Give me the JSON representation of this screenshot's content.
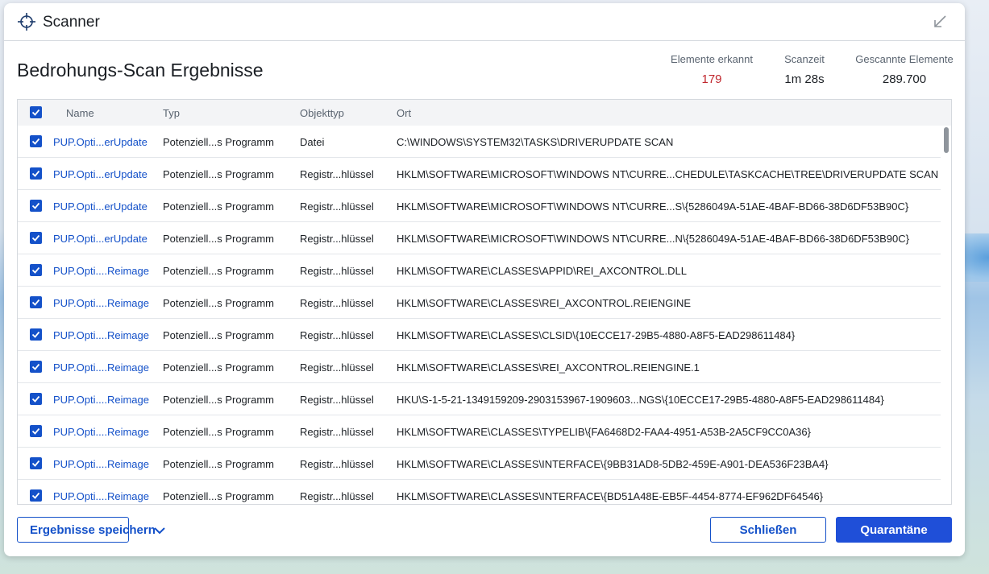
{
  "window": {
    "title": "Scanner"
  },
  "heading": "Bedrohungs-Scan Ergebnisse",
  "stats": {
    "detected_label": "Elemente erkannt",
    "detected_value": "179",
    "time_label": "Scanzeit",
    "time_value": "1m 28s",
    "scanned_label": "Gescannte Elemente",
    "scanned_value": "289.700"
  },
  "table": {
    "columns": [
      "Name",
      "Typ",
      "Objekttyp",
      "Ort"
    ],
    "rows": [
      {
        "name": "PUP.Opti...erUpdate",
        "typ": "Potenziell...s Programm",
        "obj": "Datei",
        "ort": "C:\\WINDOWS\\SYSTEM32\\TASKS\\DRIVERUPDATE SCAN"
      },
      {
        "name": "PUP.Opti...erUpdate",
        "typ": "Potenziell...s Programm",
        "obj": "Registr...hlüssel",
        "ort": "HKLM\\SOFTWARE\\MICROSOFT\\WINDOWS NT\\CURRE...CHEDULE\\TASKCACHE\\TREE\\DRIVERUPDATE SCAN"
      },
      {
        "name": "PUP.Opti...erUpdate",
        "typ": "Potenziell...s Programm",
        "obj": "Registr...hlüssel",
        "ort": "HKLM\\SOFTWARE\\MICROSOFT\\WINDOWS NT\\CURRE...S\\{5286049A-51AE-4BAF-BD66-38D6DF53B90C}"
      },
      {
        "name": "PUP.Opti...erUpdate",
        "typ": "Potenziell...s Programm",
        "obj": "Registr...hlüssel",
        "ort": "HKLM\\SOFTWARE\\MICROSOFT\\WINDOWS NT\\CURRE...N\\{5286049A-51AE-4BAF-BD66-38D6DF53B90C}"
      },
      {
        "name": "PUP.Opti....Reimage",
        "typ": "Potenziell...s Programm",
        "obj": "Registr...hlüssel",
        "ort": "HKLM\\SOFTWARE\\CLASSES\\APPID\\REI_AXCONTROL.DLL"
      },
      {
        "name": "PUP.Opti....Reimage",
        "typ": "Potenziell...s Programm",
        "obj": "Registr...hlüssel",
        "ort": "HKLM\\SOFTWARE\\CLASSES\\REI_AXCONTROL.REIENGINE"
      },
      {
        "name": "PUP.Opti....Reimage",
        "typ": "Potenziell...s Programm",
        "obj": "Registr...hlüssel",
        "ort": "HKLM\\SOFTWARE\\CLASSES\\CLSID\\{10ECCE17-29B5-4880-A8F5-EAD298611484}"
      },
      {
        "name": "PUP.Opti....Reimage",
        "typ": "Potenziell...s Programm",
        "obj": "Registr...hlüssel",
        "ort": "HKLM\\SOFTWARE\\CLASSES\\REI_AXCONTROL.REIENGINE.1"
      },
      {
        "name": "PUP.Opti....Reimage",
        "typ": "Potenziell...s Programm",
        "obj": "Registr...hlüssel",
        "ort": "HKU\\S-1-5-21-1349159209-2903153967-1909603...NGS\\{10ECCE17-29B5-4880-A8F5-EAD298611484}"
      },
      {
        "name": "PUP.Opti....Reimage",
        "typ": "Potenziell...s Programm",
        "obj": "Registr...hlüssel",
        "ort": "HKLM\\SOFTWARE\\CLASSES\\TYPELIB\\{FA6468D2-FAA4-4951-A53B-2A5CF9CC0A36}"
      },
      {
        "name": "PUP.Opti....Reimage",
        "typ": "Potenziell...s Programm",
        "obj": "Registr...hlüssel",
        "ort": "HKLM\\SOFTWARE\\CLASSES\\INTERFACE\\{9BB31AD8-5DB2-459E-A901-DEA536F23BA4}"
      },
      {
        "name": "PUP.Opti....Reimage",
        "typ": "Potenziell...s Programm",
        "obj": "Registr...hlüssel",
        "ort": "HKLM\\SOFTWARE\\CLASSES\\INTERFACE\\{BD51A48E-EB5F-4454-8774-EF962DF64546}"
      }
    ]
  },
  "buttons": {
    "save": "Ergebnisse speichern",
    "close": "Schließen",
    "quarantine": "Quarantäne"
  },
  "icons": {
    "title": "crosshair-icon",
    "collapse": "arrow-down-left-icon",
    "chevron": "chevron-down-icon"
  },
  "colors": {
    "accent": "#1451c9",
    "detected": "#c0262d"
  }
}
